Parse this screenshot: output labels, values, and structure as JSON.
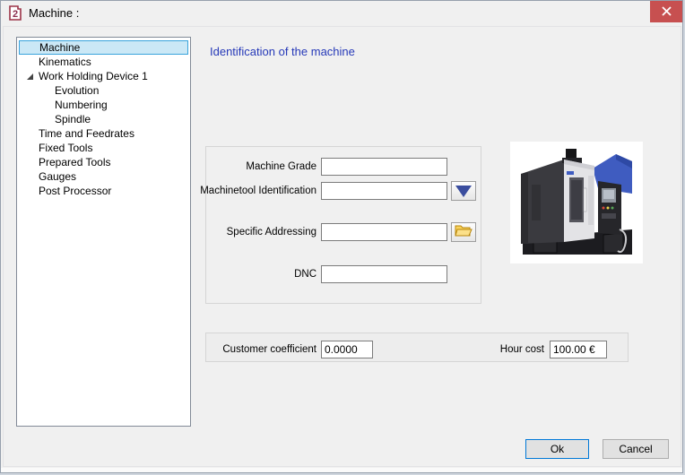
{
  "window": {
    "title": "Machine :",
    "icons": {
      "app": "go2cam-2-logo-icon",
      "close": "x-icon"
    }
  },
  "tree": {
    "items": [
      {
        "label": "Machine",
        "level": 0,
        "selected": true
      },
      {
        "label": "Kinematics",
        "level": 0
      },
      {
        "label": "Work Holding Device 1",
        "level": 0,
        "expanded": true
      },
      {
        "label": "Evolution",
        "level": 1
      },
      {
        "label": "Numbering",
        "level": 1
      },
      {
        "label": "Spindle",
        "level": 1
      },
      {
        "label": "Time and Feedrates",
        "level": 0
      },
      {
        "label": "Fixed Tools",
        "level": 0
      },
      {
        "label": "Prepared Tools",
        "level": 0
      },
      {
        "label": "Gauges",
        "level": 0
      },
      {
        "label": "Post Processor",
        "level": 0
      }
    ]
  },
  "main": {
    "heading": "Identification of the machine",
    "fields": {
      "machine_grade": {
        "label": "Machine Grade",
        "value": ""
      },
      "machinetool_identification": {
        "label": "Machinetool Identification",
        "value": "",
        "button_icon": "down-triangle-icon"
      },
      "specific_addressing": {
        "label": "Specific Addressing",
        "value": "",
        "button_icon": "open-folder-icon"
      },
      "dnc": {
        "label": "DNC",
        "value": ""
      }
    },
    "costs": {
      "customer_coefficient": {
        "label": "Customer coefficient",
        "value": "0.0000"
      },
      "hour_cost": {
        "label": "Hour cost",
        "value": "100.00 €"
      }
    },
    "photo": "cnc-machining-center-photo"
  },
  "footer": {
    "ok_label": "Ok",
    "cancel_label": "Cancel"
  },
  "colors": {
    "dialog_bg": "#f0f0f0",
    "close_red": "#c75050",
    "heading_blue": "#2639b8",
    "tree_selection_bg": "#cbe8f6",
    "tree_selection_border": "#39a3dc",
    "dropdown_triangle_navy": "#3a4d9e",
    "folder_yellow": "#f7c948",
    "ok_border_blue": "#0078d7",
    "machine_photo_blue": "#3f5cc0"
  }
}
